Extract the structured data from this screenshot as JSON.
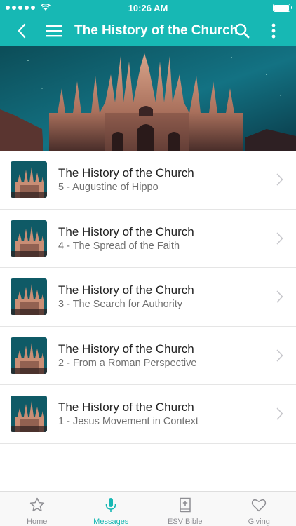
{
  "status": {
    "time": "10:26 AM",
    "battery_level": 1.0
  },
  "nav": {
    "title": "The History of the Church"
  },
  "messages": [
    {
      "title": "The History of the Church",
      "subtitle": "5 - Augustine of Hippo"
    },
    {
      "title": "The History of the Church",
      "subtitle": "4 - The Spread of the Faith"
    },
    {
      "title": "The History of the Church",
      "subtitle": "3 - The Search for Authority"
    },
    {
      "title": "The History of the Church",
      "subtitle": "2 - From a Roman Perspective"
    },
    {
      "title": "The History of the Church",
      "subtitle": "1 - Jesus Movement in Context"
    }
  ],
  "tabs": [
    {
      "label": "Home",
      "icon": "star-icon"
    },
    {
      "label": "Messages",
      "icon": "microphone-icon",
      "active": true
    },
    {
      "label": "ESV Bible",
      "icon": "bible-icon"
    },
    {
      "label": "Giving",
      "icon": "heart-icon"
    }
  ],
  "colors": {
    "accent": "#17b8b4",
    "tab_inactive": "#8e8e93"
  }
}
